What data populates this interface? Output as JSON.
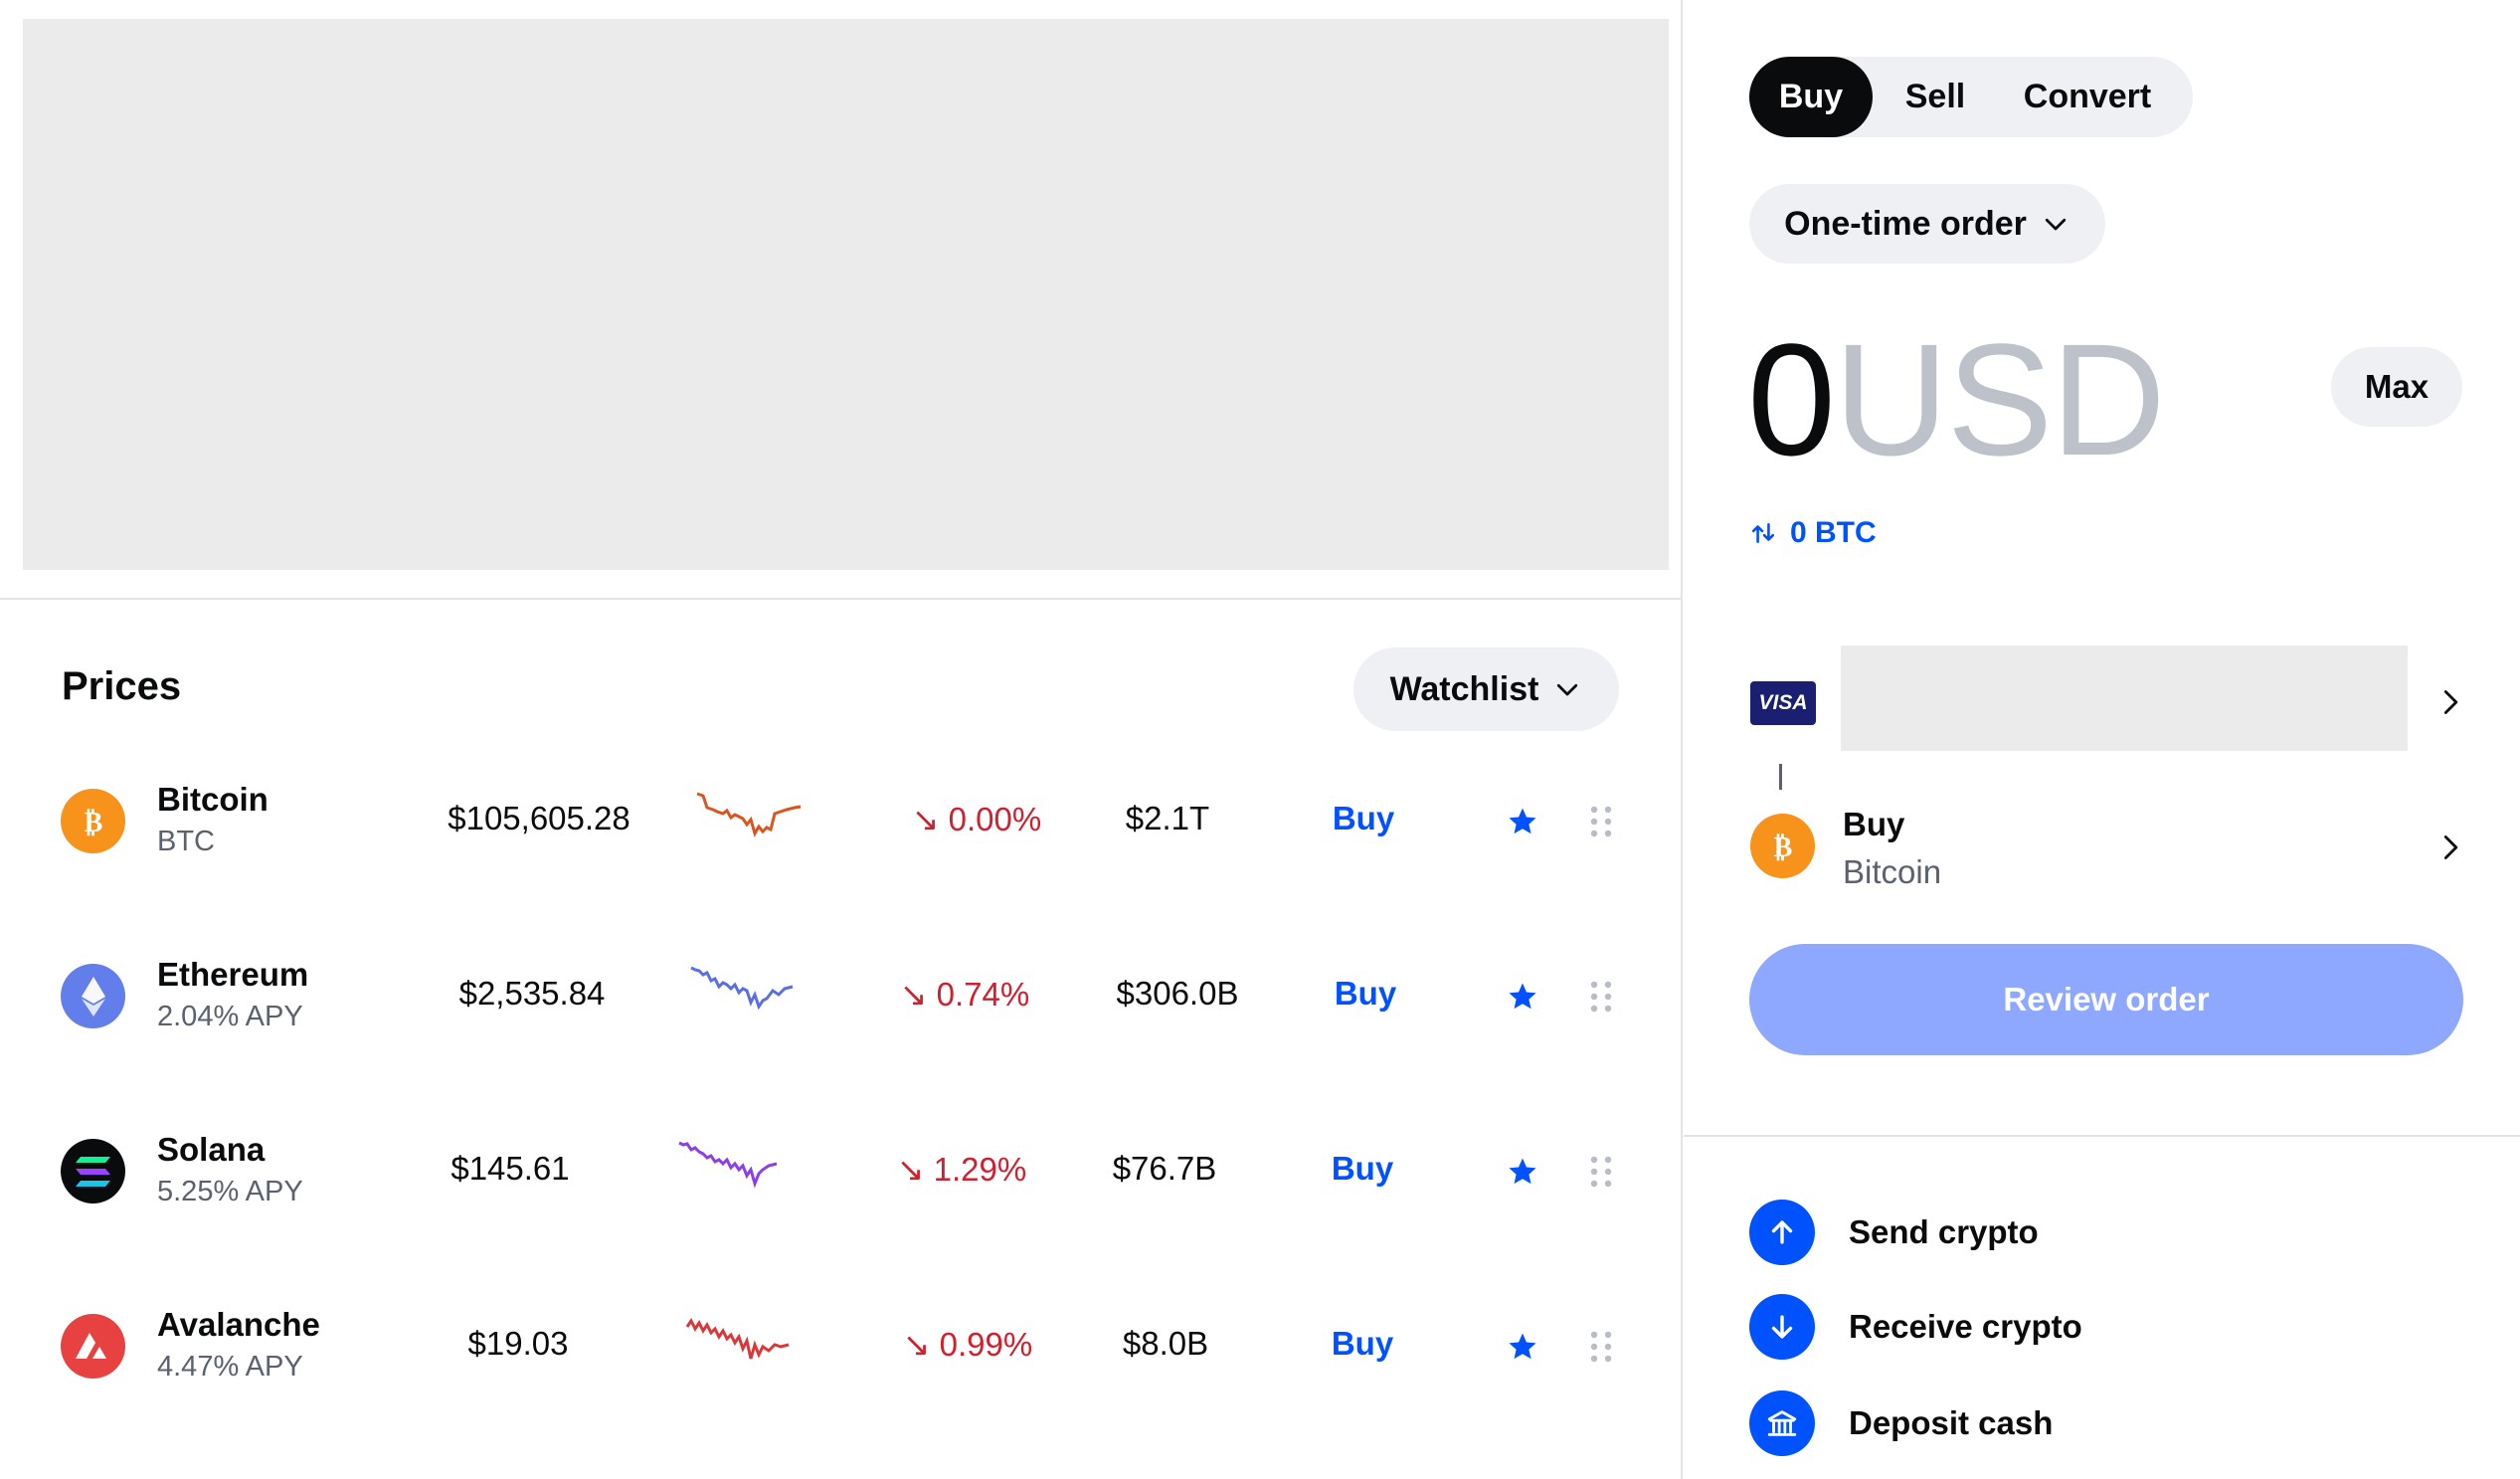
{
  "prices": {
    "title": "Prices",
    "filter_label": "Watchlist",
    "rows": [
      {
        "name": "Bitcoin",
        "sub": "BTC",
        "price": "$105,605.28",
        "change": "↘ 0.00%",
        "mcap": "$2.1T",
        "action": "Buy",
        "spark_color": "#d9541e",
        "icon_color": "#f7931a"
      },
      {
        "name": "Ethereum",
        "sub": "2.04% APY",
        "price": "$2,535.84",
        "change": "↘ 0.74%",
        "mcap": "$306.0B",
        "action": "Buy",
        "spark_color": "#5a6fe0",
        "icon_color": "#627eea"
      },
      {
        "name": "Solana",
        "sub": "5.25% APY",
        "price": "$145.61",
        "change": "↘ 1.29%",
        "mcap": "$76.7B",
        "action": "Buy",
        "spark_color": "#8a3fe8",
        "icon_color": "#0a0b0d"
      },
      {
        "name": "Avalanche",
        "sub": "4.47% APY",
        "price": "$19.03",
        "change": "↘ 0.99%",
        "mcap": "$8.0B",
        "action": "Buy",
        "spark_color": "#d9383a",
        "icon_color": "#e84142"
      }
    ]
  },
  "trade": {
    "tabs": [
      "Buy",
      "Sell",
      "Convert"
    ],
    "active_tab": "Buy",
    "order_type": "One-time order",
    "amount": "0",
    "currency": "USD",
    "max_label": "Max",
    "converted": "0 BTC",
    "payment_brand": "VISA",
    "buy_label": "Buy",
    "asset_name": "Bitcoin",
    "review_label": "Review order"
  },
  "actions": [
    {
      "label": "Send crypto",
      "icon": "arrow-up-icon"
    },
    {
      "label": "Receive crypto",
      "icon": "arrow-down-icon"
    },
    {
      "label": "Deposit cash",
      "icon": "bank-icon"
    }
  ],
  "colors": {
    "accent": "#0052ff",
    "negative": "#cf202f",
    "review_disabled": "#8ea8ff"
  }
}
